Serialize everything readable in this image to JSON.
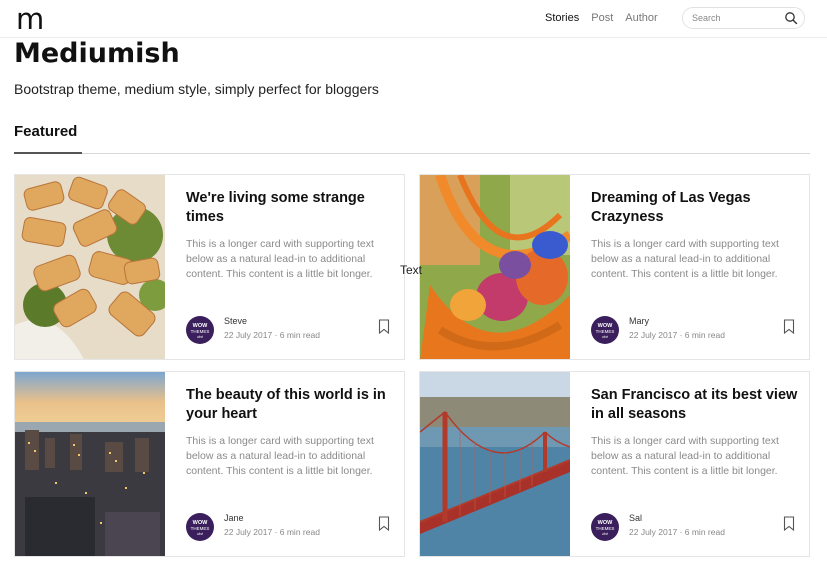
{
  "header": {
    "logo": "m",
    "nav": [
      "Stories",
      "Post",
      "Author"
    ],
    "search_placeholder": "Search"
  },
  "hero": {
    "title": "Mediumish",
    "tagline": "Bootstrap theme, medium style, simply perfect for bloggers"
  },
  "section": {
    "title": "Featured"
  },
  "avatar": {
    "line1": "WOW",
    "line2": "THEMES",
    "line3": "dot"
  },
  "floating_text": "Text",
  "cards": [
    {
      "title": "We're living some strange times",
      "excerpt": "This is a longer card with supporting text below as a natural lead-in to additional content. This content is a little bit longer.",
      "author": "Steve",
      "date": "22 July 2017 · 6 min read"
    },
    {
      "title": "Dreaming of Las Vegas Crazyness",
      "excerpt": "This is a longer card with supporting text below as a natural lead-in to additional content. This content is a little bit longer.",
      "author": "Mary",
      "date": "22 July 2017 · 6 min read"
    },
    {
      "title": "The beauty of this world is in your heart",
      "excerpt": "This is a longer card with supporting text below as a natural lead-in to additional content. This content is a little bit longer.",
      "author": "Jane",
      "date": "22 July 2017 · 6 min read"
    },
    {
      "title": "San Francisco at its best view in all seasons",
      "excerpt": "This is a longer card with supporting text below as a natural lead-in to additional content. This content is a little bit longer.",
      "author": "Sal",
      "date": "22 July 2017 · 6 min read"
    }
  ]
}
